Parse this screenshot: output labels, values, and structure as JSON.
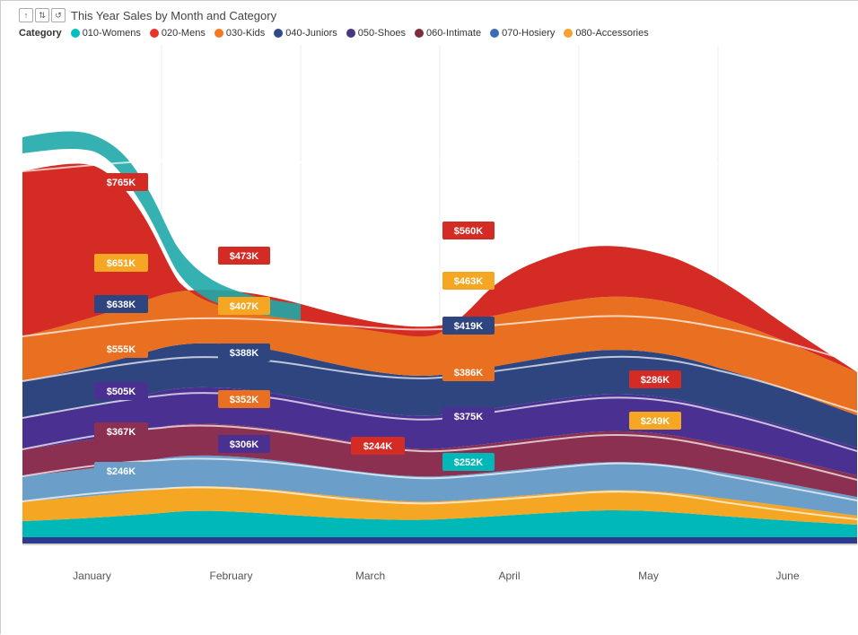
{
  "title": "This Year Sales by Month and Category",
  "legend": {
    "label": "Category",
    "items": [
      {
        "name": "010-Womens",
        "color": "#00BFBF"
      },
      {
        "name": "020-Mens",
        "color": "#E8342A"
      },
      {
        "name": "030-Kids",
        "color": "#F47920"
      },
      {
        "name": "040-Juniors",
        "color": "#2E4A8B"
      },
      {
        "name": "050-Shoes",
        "color": "#4A3580"
      },
      {
        "name": "060-Intimate",
        "color": "#7B2D42"
      },
      {
        "name": "070-Hosiery",
        "color": "#3A6DB5"
      },
      {
        "name": "080-Accessories",
        "color": "#F9A12E"
      }
    ]
  },
  "xAxis": {
    "labels": [
      "January",
      "February",
      "March",
      "April",
      "May",
      "June"
    ]
  },
  "dataLabels": {
    "january": [
      "$765K",
      "$651K",
      "$638K",
      "$555K",
      "$505K",
      "$367K",
      "$246K"
    ],
    "february": [
      "$473K",
      "$407K",
      "$388K",
      "$352K",
      "$306K"
    ],
    "march": [
      "$244K"
    ],
    "april": [
      "$560K",
      "$463K",
      "$419K",
      "$386K",
      "$375K",
      "$252K"
    ],
    "may": [
      "$286K",
      "$249K"
    ]
  },
  "icons": {
    "up_arrow": "↑",
    "down_arrows": "↓↓",
    "refresh": "↺"
  }
}
